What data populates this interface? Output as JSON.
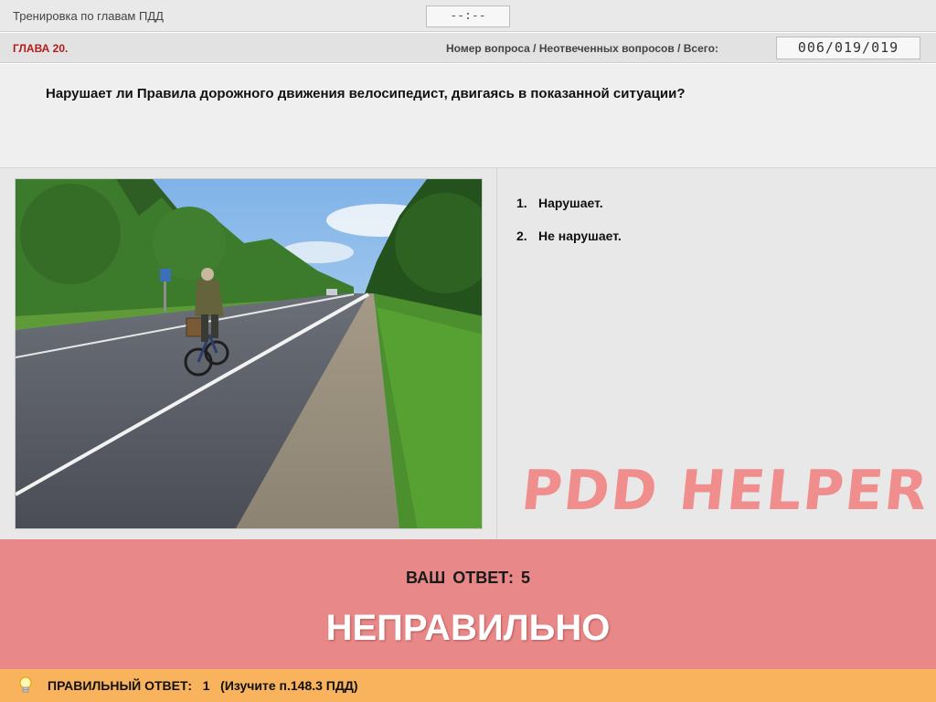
{
  "header": {
    "mode_title": "Тренировка по главам ПДД",
    "timer": "--:--"
  },
  "chapter_bar": {
    "chapter": "ГЛАВА 20.",
    "counter_label": "Номер вопроса / Неотвеченных вопросов / Всего:",
    "counter_value": "006/019/019"
  },
  "question": {
    "text": "Нарушает ли Правила дорожного движения велосипедист, двигаясь в показанной ситуации?",
    "image_icon": "road-cyclist-photo"
  },
  "answers": [
    {
      "number": "1.",
      "label": "Нарушает."
    },
    {
      "number": "2.",
      "label": "Не нарушает."
    }
  ],
  "watermark": "PDD HELPER",
  "result": {
    "your_answer": "ВАШ ОТВЕТ: 5",
    "verdict": "НЕПРАВИЛЬНО",
    "color": "#e88888"
  },
  "correct": {
    "text": "ПРАВИЛЬНЫЙ ОТВЕТ:   1   (Изучите п.148.3 ПДД)",
    "icon": "lightbulb-icon",
    "color": "#f8b35c"
  }
}
